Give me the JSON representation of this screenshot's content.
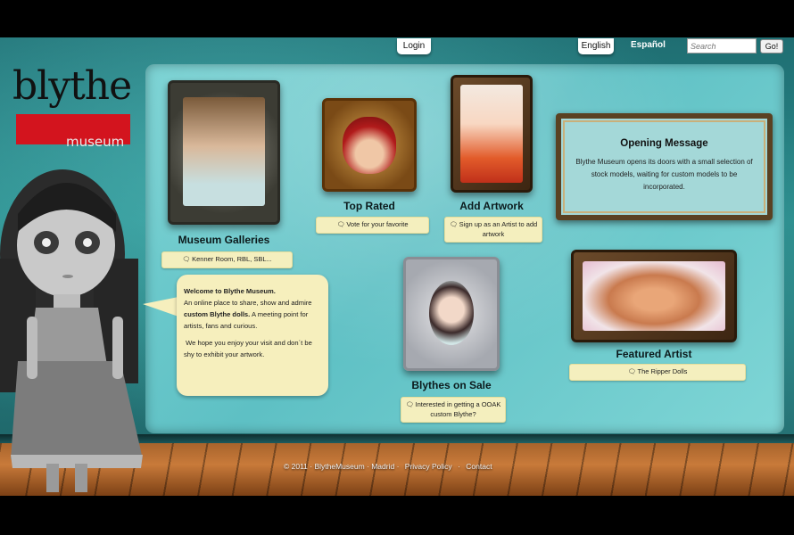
{
  "header": {
    "login_label": "Login",
    "lang_english": "English",
    "lang_spanish": "Español",
    "search_placeholder": "Search",
    "search_button": "Go!"
  },
  "logo": {
    "word": "blythe",
    "sub": "museum"
  },
  "sections": {
    "galleries": {
      "title": "Museum Galleries",
      "tag": "Kenner Room, RBL, SBL..."
    },
    "top_rated": {
      "title": "Top Rated",
      "tag": "Vote for your favorite"
    },
    "artwork": {
      "title": "Add Artwork",
      "tag": "Sign up as an Artist to add artwork"
    },
    "on_sale": {
      "title": "Blythes on Sale",
      "tag": "Interested in getting a OOAK custom Blythe?"
    },
    "featured": {
      "title": "Featured Artist",
      "tag": "The Ripper Dolls"
    }
  },
  "welcome": {
    "heading": "Welcome to Blythe Museum.",
    "line1": "An online place to share, show and admire ",
    "bold": "custom Blythe dolls.",
    "line2": " A meeting point for artists, fans and curious.",
    "closing": "We hope you enjoy your visit and don´t be shy to exhibit your artwork."
  },
  "opening": {
    "title": "Opening Message",
    "body": "Blythe Museum opens its doors with a small selection of stock models, waiting for custom models to be incorporated."
  },
  "footer": {
    "copyright": "© 2011 · BlytheMuseum · Madrid ·",
    "privacy": "Privacy Policy",
    "separator": "·",
    "contact": "Contact"
  },
  "colors": {
    "logo_red": "#d3141e",
    "tag_bg": "#f4efbe",
    "panel": "#6cc8cb"
  }
}
